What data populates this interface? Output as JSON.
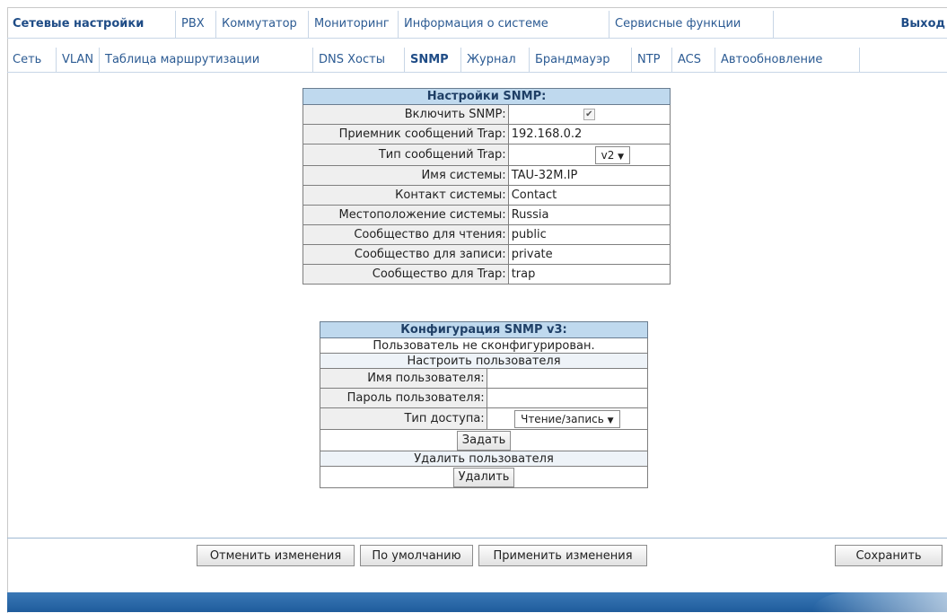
{
  "nav_primary": {
    "tabs": [
      {
        "label": "Сетевые настройки",
        "active": true
      },
      {
        "label": "PBX",
        "active": false
      },
      {
        "label": "Коммутатор",
        "active": false
      },
      {
        "label": "Мониторинг",
        "active": false
      },
      {
        "label": "Информация о системе",
        "active": false
      },
      {
        "label": "Сервисные функции",
        "active": false
      }
    ],
    "exit_label": "Выход"
  },
  "nav_secondary": {
    "tabs": [
      {
        "label": "Сеть",
        "active": false
      },
      {
        "label": "VLAN",
        "active": false
      },
      {
        "label": "Таблица маршрутизации",
        "active": false
      },
      {
        "label": "DNS Хосты",
        "active": false
      },
      {
        "label": "SNMP",
        "active": true
      },
      {
        "label": "Журнал",
        "active": false
      },
      {
        "label": "Брандмауэр",
        "active": false
      },
      {
        "label": "NTP",
        "active": false
      },
      {
        "label": "ACS",
        "active": false
      },
      {
        "label": "Автообновление",
        "active": false
      }
    ]
  },
  "snmp": {
    "title": "Настройки SNMP:",
    "enable_label": "Включить SNMP:",
    "enable_checked": true,
    "enable_mark": "✔",
    "trap_receiver_label": "Приемник сообщений Trap:",
    "trap_receiver_value": "192.168.0.2",
    "trap_type_label": "Тип сообщений Trap:",
    "trap_type_value": "v2",
    "system_name_label": "Имя системы:",
    "system_name_value": "TAU-32M.IP",
    "system_contact_label": "Контакт системы:",
    "system_contact_value": "Contact",
    "system_location_label": "Местоположение системы:",
    "system_location_value": "Russia",
    "read_community_label": "Сообщество для чтения:",
    "read_community_value": "public",
    "write_community_label": "Сообщество для записи:",
    "write_community_value": "private",
    "trap_community_label": "Сообщество для Trap:",
    "trap_community_value": "trap"
  },
  "snmpv3": {
    "title": "Конфигурация SNMP v3:",
    "status_note": "Пользователь не сконфигурирован.",
    "setup_heading": "Настроить пользователя",
    "username_label": "Имя пользователя:",
    "username_value": "",
    "password_label": "Пароль пользователя:",
    "password_value": "",
    "access_label": "Тип доступа:",
    "access_value": "Чтение/запись",
    "set_button": "Задать",
    "delete_heading": "Удалить пользователя",
    "delete_button": "Удалить"
  },
  "actions": {
    "cancel": "Отменить изменения",
    "defaults": "По умолчанию",
    "apply": "Применить изменения",
    "save": "Сохранить"
  },
  "icons": {
    "dropdown_arrow": "▼"
  }
}
